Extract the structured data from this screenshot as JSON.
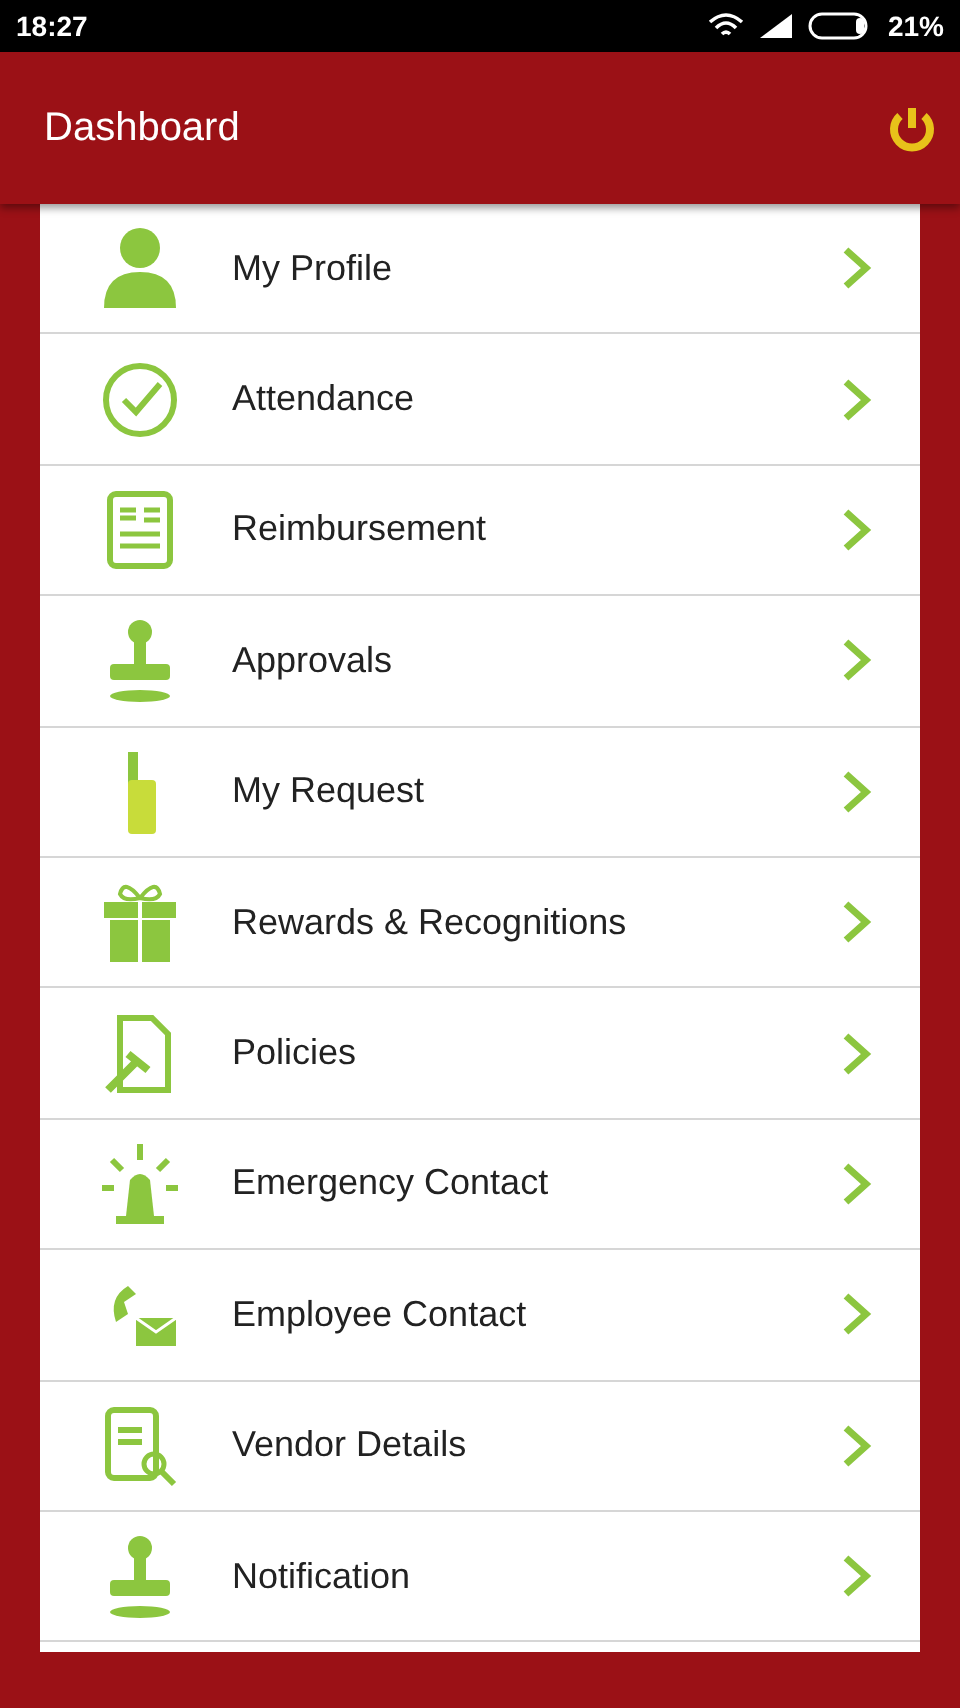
{
  "status_bar": {
    "time": "18:27",
    "battery": "21%"
  },
  "app_bar": {
    "title": "Dashboard"
  },
  "menu": [
    {
      "label": "My Profile"
    },
    {
      "label": "Attendance"
    },
    {
      "label": "Reimbursement"
    },
    {
      "label": "Approvals"
    },
    {
      "label": "My Request"
    },
    {
      "label": "Rewards & Recognitions"
    },
    {
      "label": "Policies"
    },
    {
      "label": "Emergency Contact"
    },
    {
      "label": "Employee Contact"
    },
    {
      "label": "Vendor Details"
    },
    {
      "label": "Notification"
    }
  ]
}
